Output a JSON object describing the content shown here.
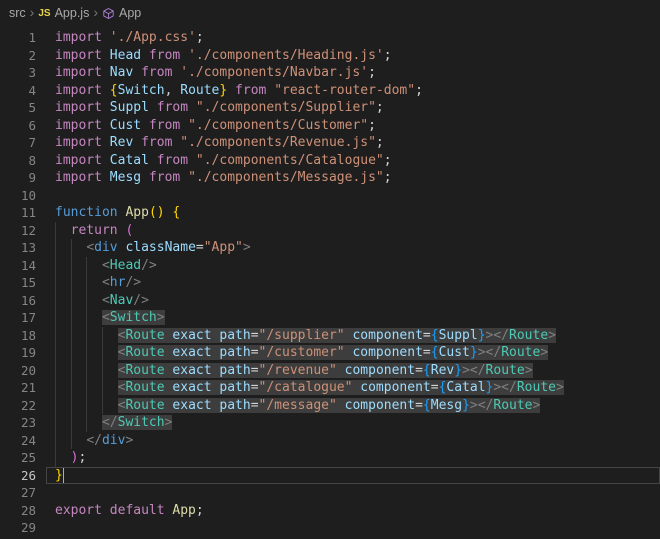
{
  "breadcrumb": {
    "separator": "›",
    "js_icon_text": "JS",
    "items": [
      {
        "label": "src"
      },
      {
        "label": "App.js"
      },
      {
        "label": "App"
      }
    ]
  },
  "colors": {
    "bg": "#1e1e1e",
    "breadcrumb_fg": "#a9a9a9",
    "js_icon": "#e8d44d",
    "symbol_icon": "#b180d7",
    "gutter": "#858585",
    "gutter_active": "#c6c6c6",
    "guide": "#3a3a3a",
    "current_line_border": "#454545",
    "highlight": "rgba(87,87,87,0.55)",
    "kw": "#C586C0",
    "blue": "#569CD6",
    "fn": "#DCDCAA",
    "var": "#9CDCFE",
    "str": "#CE9178",
    "pun": "#D4D4D4",
    "tagp": "#808080",
    "comp": "#4EC9B4",
    "b1": "#FFD700",
    "b2": "#DA70D6",
    "b3": "#179FFF"
  },
  "editor": {
    "current_line": 26,
    "lines": [
      {
        "num": 1,
        "tokens": [
          {
            "t": "import ",
            "c": "kw"
          },
          {
            "t": "'./App.css'",
            "c": "str"
          },
          {
            "t": ";",
            "c": "pun"
          }
        ]
      },
      {
        "num": 2,
        "tokens": [
          {
            "t": "import ",
            "c": "kw"
          },
          {
            "t": "Head",
            "c": "var"
          },
          {
            "t": " from ",
            "c": "kw"
          },
          {
            "t": "'./components/Heading.js'",
            "c": "str"
          },
          {
            "t": ";",
            "c": "pun"
          }
        ]
      },
      {
        "num": 3,
        "tokens": [
          {
            "t": "import ",
            "c": "kw"
          },
          {
            "t": "Nav",
            "c": "var"
          },
          {
            "t": " from ",
            "c": "kw"
          },
          {
            "t": "'./components/Navbar.js'",
            "c": "str"
          },
          {
            "t": ";",
            "c": "pun"
          }
        ]
      },
      {
        "num": 4,
        "tokens": [
          {
            "t": "import ",
            "c": "kw"
          },
          {
            "t": "{",
            "c": "b1"
          },
          {
            "t": "Switch",
            "c": "var"
          },
          {
            "t": ", ",
            "c": "pun"
          },
          {
            "t": "Route",
            "c": "var"
          },
          {
            "t": "}",
            "c": "b1"
          },
          {
            "t": " from ",
            "c": "kw"
          },
          {
            "t": "\"react-router-dom\"",
            "c": "str"
          },
          {
            "t": ";",
            "c": "pun"
          }
        ]
      },
      {
        "num": 5,
        "tokens": [
          {
            "t": "import ",
            "c": "kw"
          },
          {
            "t": "Suppl",
            "c": "var"
          },
          {
            "t": " from ",
            "c": "kw"
          },
          {
            "t": "\"./components/Supplier\"",
            "c": "str"
          },
          {
            "t": ";",
            "c": "pun"
          }
        ]
      },
      {
        "num": 6,
        "tokens": [
          {
            "t": "import ",
            "c": "kw"
          },
          {
            "t": "Cust",
            "c": "var"
          },
          {
            "t": " from ",
            "c": "kw"
          },
          {
            "t": "\"./components/Customer\"",
            "c": "str"
          },
          {
            "t": ";",
            "c": "pun"
          }
        ]
      },
      {
        "num": 7,
        "tokens": [
          {
            "t": "import ",
            "c": "kw"
          },
          {
            "t": "Rev",
            "c": "var"
          },
          {
            "t": " from ",
            "c": "kw"
          },
          {
            "t": "\"./components/Revenue.js\"",
            "c": "str"
          },
          {
            "t": ";",
            "c": "pun"
          }
        ]
      },
      {
        "num": 8,
        "tokens": [
          {
            "t": "import ",
            "c": "kw"
          },
          {
            "t": "Catal",
            "c": "var"
          },
          {
            "t": " from ",
            "c": "kw"
          },
          {
            "t": "\"./components/Catalogue\"",
            "c": "str"
          },
          {
            "t": ";",
            "c": "pun"
          }
        ]
      },
      {
        "num": 9,
        "tokens": [
          {
            "t": "import ",
            "c": "kw"
          },
          {
            "t": "Mesg",
            "c": "var"
          },
          {
            "t": " from ",
            "c": "kw"
          },
          {
            "t": "\"./components/Message.js\"",
            "c": "str"
          },
          {
            "t": ";",
            "c": "pun"
          }
        ]
      },
      {
        "num": 10,
        "tokens": []
      },
      {
        "num": 11,
        "tokens": [
          {
            "t": "function ",
            "c": "blue"
          },
          {
            "t": "App",
            "c": "fn"
          },
          {
            "t": "() {",
            "c": "b1"
          }
        ]
      },
      {
        "num": 12,
        "tokens": [
          {
            "t": "  ",
            "c": "ws"
          },
          {
            "t": "return ",
            "c": "kw"
          },
          {
            "t": "(",
            "c": "b2"
          }
        ]
      },
      {
        "num": 13,
        "tokens": [
          {
            "t": "    ",
            "c": "ws"
          },
          {
            "t": "<",
            "c": "tagp"
          },
          {
            "t": "div",
            "c": "blue"
          },
          {
            "t": " ",
            "c": "ws"
          },
          {
            "t": "className",
            "c": "var"
          },
          {
            "t": "=",
            "c": "pun"
          },
          {
            "t": "\"App\"",
            "c": "str"
          },
          {
            "t": ">",
            "c": "tagp"
          }
        ]
      },
      {
        "num": 14,
        "tokens": [
          {
            "t": "      ",
            "c": "ws"
          },
          {
            "t": "<",
            "c": "tagp"
          },
          {
            "t": "Head",
            "c": "comp"
          },
          {
            "t": "/>",
            "c": "tagp"
          }
        ]
      },
      {
        "num": 15,
        "tokens": [
          {
            "t": "      ",
            "c": "ws"
          },
          {
            "t": "<",
            "c": "tagp"
          },
          {
            "t": "hr",
            "c": "blue"
          },
          {
            "t": "/>",
            "c": "tagp"
          }
        ]
      },
      {
        "num": 16,
        "tokens": [
          {
            "t": "      ",
            "c": "ws"
          },
          {
            "t": "<",
            "c": "tagp"
          },
          {
            "t": "Nav",
            "c": "comp"
          },
          {
            "t": "/>",
            "c": "tagp"
          }
        ]
      },
      {
        "num": 17,
        "tokens": [
          {
            "t": "      ",
            "c": "ws"
          },
          {
            "t": "<",
            "c": "tagp",
            "h": true
          },
          {
            "t": "Switch",
            "c": "comp",
            "h": true
          },
          {
            "t": ">",
            "c": "tagp",
            "h": true
          }
        ]
      },
      {
        "num": 18,
        "tokens": [
          {
            "t": "        ",
            "c": "ws"
          },
          {
            "t": "<",
            "c": "tagp",
            "h": true
          },
          {
            "t": "Route",
            "c": "comp",
            "h": true
          },
          {
            "t": " ",
            "c": "ws",
            "h": true
          },
          {
            "t": "exact",
            "c": "var",
            "h": true
          },
          {
            "t": " ",
            "c": "ws",
            "h": true
          },
          {
            "t": "path",
            "c": "var",
            "h": true
          },
          {
            "t": "=",
            "c": "pun",
            "h": true
          },
          {
            "t": "\"/supplier\"",
            "c": "str",
            "h": true
          },
          {
            "t": " ",
            "c": "ws",
            "h": true
          },
          {
            "t": "component",
            "c": "var",
            "h": true
          },
          {
            "t": "=",
            "c": "pun",
            "h": true
          },
          {
            "t": "{",
            "c": "b3",
            "h": true
          },
          {
            "t": "Suppl",
            "c": "var",
            "h": true
          },
          {
            "t": "}",
            "c": "b3",
            "h": true
          },
          {
            "t": "></",
            "c": "tagp",
            "h": true
          },
          {
            "t": "Route",
            "c": "comp",
            "h": true
          },
          {
            "t": ">",
            "c": "tagp",
            "h": true
          }
        ]
      },
      {
        "num": 19,
        "tokens": [
          {
            "t": "        ",
            "c": "ws"
          },
          {
            "t": "<",
            "c": "tagp",
            "h": true
          },
          {
            "t": "Route",
            "c": "comp",
            "h": true
          },
          {
            "t": " ",
            "c": "ws",
            "h": true
          },
          {
            "t": "exact",
            "c": "var",
            "h": true
          },
          {
            "t": " ",
            "c": "ws",
            "h": true
          },
          {
            "t": "path",
            "c": "var",
            "h": true
          },
          {
            "t": "=",
            "c": "pun",
            "h": true
          },
          {
            "t": "\"/customer\"",
            "c": "str",
            "h": true
          },
          {
            "t": " ",
            "c": "ws",
            "h": true
          },
          {
            "t": "component",
            "c": "var",
            "h": true
          },
          {
            "t": "=",
            "c": "pun",
            "h": true
          },
          {
            "t": "{",
            "c": "b3",
            "h": true
          },
          {
            "t": "Cust",
            "c": "var",
            "h": true
          },
          {
            "t": "}",
            "c": "b3",
            "h": true
          },
          {
            "t": "></",
            "c": "tagp",
            "h": true
          },
          {
            "t": "Route",
            "c": "comp",
            "h": true
          },
          {
            "t": ">",
            "c": "tagp",
            "h": true
          }
        ]
      },
      {
        "num": 20,
        "tokens": [
          {
            "t": "        ",
            "c": "ws"
          },
          {
            "t": "<",
            "c": "tagp",
            "h": true
          },
          {
            "t": "Route",
            "c": "comp",
            "h": true
          },
          {
            "t": " ",
            "c": "ws",
            "h": true
          },
          {
            "t": "exact",
            "c": "var",
            "h": true
          },
          {
            "t": " ",
            "c": "ws",
            "h": true
          },
          {
            "t": "path",
            "c": "var",
            "h": true
          },
          {
            "t": "=",
            "c": "pun",
            "h": true
          },
          {
            "t": "\"/revenue\"",
            "c": "str",
            "h": true
          },
          {
            "t": " ",
            "c": "ws",
            "h": true
          },
          {
            "t": "component",
            "c": "var",
            "h": true
          },
          {
            "t": "=",
            "c": "pun",
            "h": true
          },
          {
            "t": "{",
            "c": "b3",
            "h": true
          },
          {
            "t": "Rev",
            "c": "var",
            "h": true
          },
          {
            "t": "}",
            "c": "b3",
            "h": true
          },
          {
            "t": "></",
            "c": "tagp",
            "h": true
          },
          {
            "t": "Route",
            "c": "comp",
            "h": true
          },
          {
            "t": ">",
            "c": "tagp",
            "h": true
          }
        ]
      },
      {
        "num": 21,
        "tokens": [
          {
            "t": "        ",
            "c": "ws"
          },
          {
            "t": "<",
            "c": "tagp",
            "h": true
          },
          {
            "t": "Route",
            "c": "comp",
            "h": true
          },
          {
            "t": " ",
            "c": "ws",
            "h": true
          },
          {
            "t": "exact",
            "c": "var",
            "h": true
          },
          {
            "t": " ",
            "c": "ws",
            "h": true
          },
          {
            "t": "path",
            "c": "var",
            "h": true
          },
          {
            "t": "=",
            "c": "pun",
            "h": true
          },
          {
            "t": "\"/catalogue\"",
            "c": "str",
            "h": true
          },
          {
            "t": " ",
            "c": "ws",
            "h": true
          },
          {
            "t": "component",
            "c": "var",
            "h": true
          },
          {
            "t": "=",
            "c": "pun",
            "h": true
          },
          {
            "t": "{",
            "c": "b3",
            "h": true
          },
          {
            "t": "Catal",
            "c": "var",
            "h": true
          },
          {
            "t": "}",
            "c": "b3",
            "h": true
          },
          {
            "t": "></",
            "c": "tagp",
            "h": true
          },
          {
            "t": "Route",
            "c": "comp",
            "h": true
          },
          {
            "t": ">",
            "c": "tagp",
            "h": true
          }
        ]
      },
      {
        "num": 22,
        "tokens": [
          {
            "t": "        ",
            "c": "ws"
          },
          {
            "t": "<",
            "c": "tagp",
            "h": true
          },
          {
            "t": "Route",
            "c": "comp",
            "h": true
          },
          {
            "t": " ",
            "c": "ws",
            "h": true
          },
          {
            "t": "exact",
            "c": "var",
            "h": true
          },
          {
            "t": " ",
            "c": "ws",
            "h": true
          },
          {
            "t": "path",
            "c": "var",
            "h": true
          },
          {
            "t": "=",
            "c": "pun",
            "h": true
          },
          {
            "t": "\"/message\"",
            "c": "str",
            "h": true
          },
          {
            "t": " ",
            "c": "ws",
            "h": true
          },
          {
            "t": "component",
            "c": "var",
            "h": true
          },
          {
            "t": "=",
            "c": "pun",
            "h": true
          },
          {
            "t": "{",
            "c": "b3",
            "h": true
          },
          {
            "t": "Mesg",
            "c": "var",
            "h": true
          },
          {
            "t": "}",
            "c": "b3",
            "h": true
          },
          {
            "t": "></",
            "c": "tagp",
            "h": true
          },
          {
            "t": "Route",
            "c": "comp",
            "h": true
          },
          {
            "t": ">",
            "c": "tagp",
            "h": true
          }
        ]
      },
      {
        "num": 23,
        "tokens": [
          {
            "t": "      ",
            "c": "ws"
          },
          {
            "t": "</",
            "c": "tagp",
            "h": true
          },
          {
            "t": "Switch",
            "c": "comp",
            "h": true
          },
          {
            "t": ">",
            "c": "tagp",
            "h": true
          }
        ]
      },
      {
        "num": 24,
        "tokens": [
          {
            "t": "    ",
            "c": "ws"
          },
          {
            "t": "</",
            "c": "tagp"
          },
          {
            "t": "div",
            "c": "blue"
          },
          {
            "t": ">",
            "c": "tagp"
          }
        ]
      },
      {
        "num": 25,
        "tokens": [
          {
            "t": "  ",
            "c": "ws"
          },
          {
            "t": ")",
            "c": "b2"
          },
          {
            "t": ";",
            "c": "pun"
          }
        ]
      },
      {
        "num": 26,
        "cursor": 1,
        "tokens": [
          {
            "t": "}",
            "c": "b1"
          }
        ]
      },
      {
        "num": 27,
        "tokens": []
      },
      {
        "num": 28,
        "tokens": [
          {
            "t": "export default ",
            "c": "kw"
          },
          {
            "t": "App",
            "c": "fn"
          },
          {
            "t": ";",
            "c": "pun"
          }
        ]
      },
      {
        "num": 29,
        "tokens": []
      }
    ]
  }
}
